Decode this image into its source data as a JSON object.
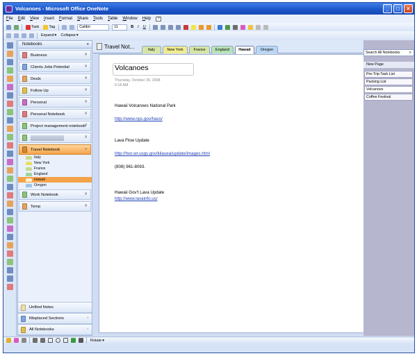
{
  "window": {
    "title": "Volcanoes - Microsoft Office OneNote"
  },
  "menu": [
    "File",
    "Edit",
    "View",
    "Insert",
    "Format",
    "Share",
    "Tools",
    "Table",
    "Window",
    "Help"
  ],
  "toolbar": {
    "task_label": "Task",
    "tag_label": "Tag",
    "font_name": "Calibri",
    "font_size": "11",
    "bold": "B",
    "italic": "I",
    "underline": "U",
    "expand_label": "Expand",
    "collapse_label": "Collapse"
  },
  "navigation": {
    "header": "Notebooks",
    "notebooks": [
      {
        "label": "Business",
        "color": "#e07b7b"
      },
      {
        "label": "Clients Jobs Potential",
        "color": "#7fa6e0"
      },
      {
        "label": "Deals",
        "color": "#e6a35c"
      },
      {
        "label": "Follow Up",
        "color": "#e0c14a"
      },
      {
        "label": "Personal",
        "color": "#c86dc6"
      },
      {
        "label": "Personal Notebook",
        "color": "#e07b7b"
      },
      {
        "label": "Project management notebook",
        "color": "#8bc47a"
      },
      {
        "label": "",
        "color": "#8bc47a"
      }
    ],
    "active_notebook": {
      "label": "Travel Notebook",
      "color": "#d9842f"
    },
    "sections": [
      {
        "label": "Italy",
        "color": "#c6d98f"
      },
      {
        "label": "New York",
        "color": "#e8df66"
      },
      {
        "label": "France",
        "color": "#c6d98f"
      },
      {
        "label": "England",
        "color": "#9fd39b"
      },
      {
        "label": "Hawaii",
        "color": "#f5c56a"
      },
      {
        "label": "Oregon",
        "color": "#9cc3e8"
      }
    ],
    "more_notebooks": [
      {
        "label": "Work Notebook",
        "color": "#8bc47a"
      },
      {
        "label": "Temp",
        "color": "#e6a35c"
      }
    ],
    "bottom": [
      {
        "label": "Unfiled Notes"
      },
      {
        "label": "Misplaced Sections"
      },
      {
        "label": "All Notebooks"
      }
    ]
  },
  "tabs": {
    "notebook_title": "Travel Not...",
    "items": [
      {
        "label": "Italy",
        "color": "#d6e6a4"
      },
      {
        "label": "New York",
        "color": "#f1ec8e"
      },
      {
        "label": "France",
        "color": "#d6e6a4"
      },
      {
        "label": "England",
        "color": "#b8e3b4"
      },
      {
        "label": "Hawaii",
        "color": "#ffffff"
      },
      {
        "label": "Oregon",
        "color": "#b9d6f2"
      }
    ],
    "active": "Hawaii"
  },
  "page": {
    "title": "Volcanoes",
    "date": "Thursday, October 30, 2008",
    "time": "6:18 AM",
    "notes": [
      {
        "text": "Hawaii Volcanoes National Park",
        "type": "text"
      },
      {
        "text": "http://www.nps.gov/havo/",
        "type": "link"
      },
      {
        "text": "Lava Flow Update",
        "type": "text"
      },
      {
        "text": "http://hvo.wr.usgs.gov/kilauea/update/images.html",
        "type": "link"
      },
      {
        "text": "(808) 961-8093.",
        "type": "text"
      },
      {
        "text": "Hawaii Gov't Lava Update",
        "type": "text"
      },
      {
        "text": "http://www.lavainfo.us/",
        "type": "link"
      }
    ]
  },
  "pagelist": {
    "search_placeholder": "Search All Notebooks",
    "new_page_label": "New Page",
    "pages": [
      "Pre-Trip Task List",
      "Packing List",
      "Volcanoes",
      "Coffee Festival"
    ],
    "selected": "Volcanoes"
  },
  "drawbar": {
    "rotate_label": "Rotate"
  }
}
